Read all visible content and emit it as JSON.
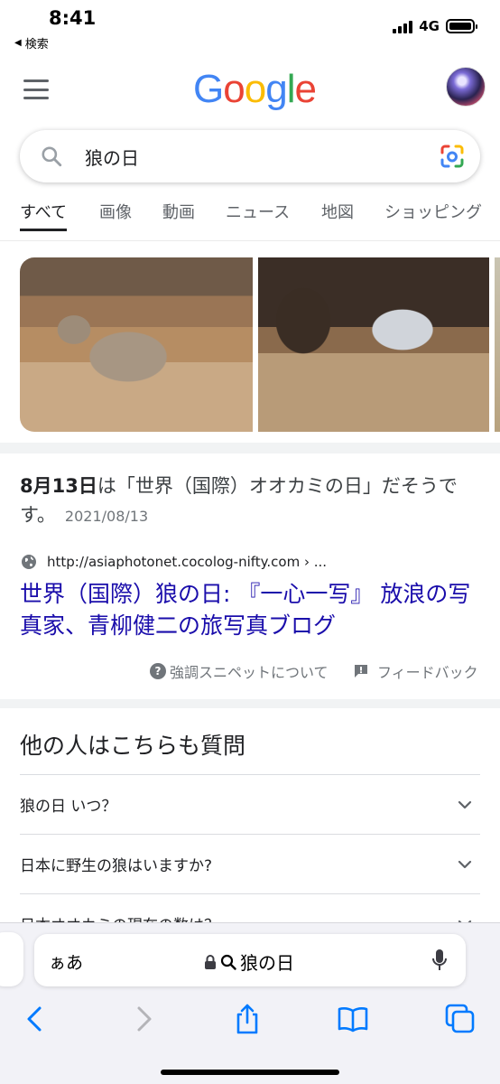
{
  "status_bar": {
    "time": "8:41",
    "back_label": "検索",
    "network": "4G"
  },
  "google": {
    "logo": [
      {
        "ch": "G",
        "color": "#4285F4"
      },
      {
        "ch": "o",
        "color": "#EA4335"
      },
      {
        "ch": "o",
        "color": "#FBBC05"
      },
      {
        "ch": "g",
        "color": "#4285F4"
      },
      {
        "ch": "l",
        "color": "#34A853"
      },
      {
        "ch": "e",
        "color": "#EA4335"
      }
    ],
    "query": "狼の日"
  },
  "tabs": [
    {
      "label": "すべて",
      "active": true
    },
    {
      "label": "画像",
      "active": false
    },
    {
      "label": "動画",
      "active": false
    },
    {
      "label": "ニュース",
      "active": false
    },
    {
      "label": "地図",
      "active": false
    },
    {
      "label": "ショッピング",
      "active": false
    }
  ],
  "featured_snippet": {
    "bold_part": "8月13日",
    "text": "は「世界（国際）オオカミの日」だそうです。",
    "date": "2021/08/13",
    "source_url": "http://asiaphotonet.cocolog-nifty.com › ...",
    "title": "世界（国際）狼の日: 『一心一写』 放浪の写真家、青柳健二の旅写真ブログ",
    "about_label": "強調スニペットについて",
    "feedback_label": "フィードバック"
  },
  "people_also_ask": {
    "heading": "他の人はこちらも質問",
    "questions": [
      "狼の日 いつ？",
      "日本に野生の狼はいますか?",
      "日本オオカミの現在の数は？"
    ]
  },
  "safari": {
    "text_size_label": "ぁあ",
    "address_text": "狼の日"
  }
}
